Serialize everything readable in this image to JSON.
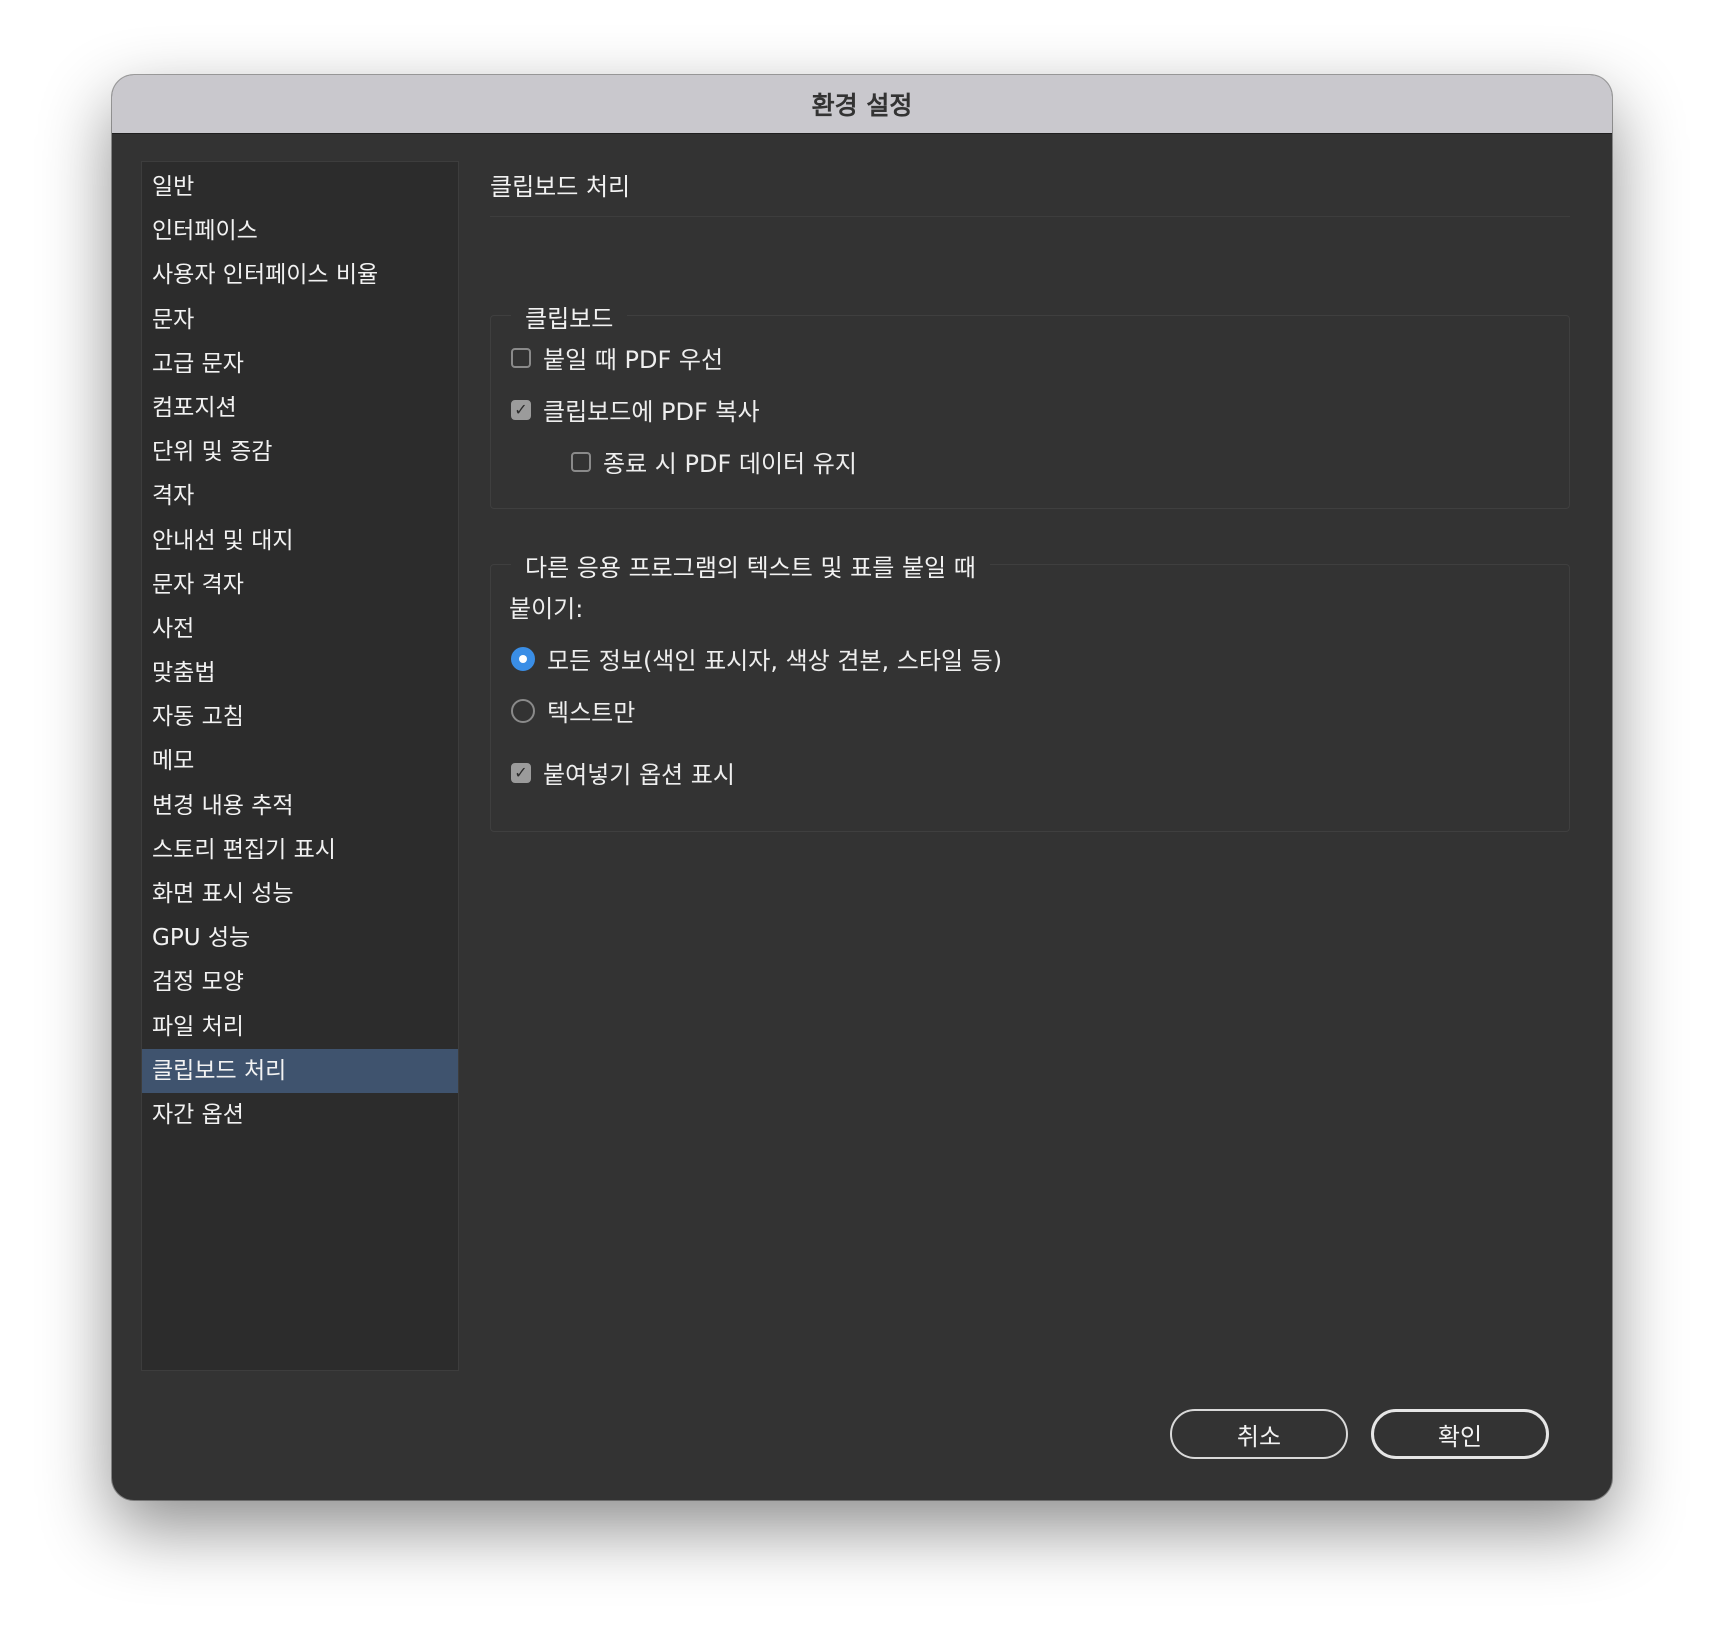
{
  "window": {
    "title": "환경 설정"
  },
  "sidebar": {
    "items": [
      {
        "label": "일반"
      },
      {
        "label": "인터페이스"
      },
      {
        "label": "사용자 인터페이스 비율"
      },
      {
        "label": "문자"
      },
      {
        "label": "고급 문자"
      },
      {
        "label": "컴포지션"
      },
      {
        "label": "단위 및 증감"
      },
      {
        "label": "격자"
      },
      {
        "label": "안내선 및 대지"
      },
      {
        "label": "문자 격자"
      },
      {
        "label": "사전"
      },
      {
        "label": "맞춤법"
      },
      {
        "label": "자동 고침"
      },
      {
        "label": "메모"
      },
      {
        "label": "변경 내용 추적"
      },
      {
        "label": "스토리 편집기 표시"
      },
      {
        "label": "화면 표시 성능"
      },
      {
        "label": "GPU 성능"
      },
      {
        "label": "검정 모양"
      },
      {
        "label": "파일 처리"
      },
      {
        "label": "클립보드 처리"
      },
      {
        "label": "자간 옵션"
      }
    ],
    "selected": "클립보드 처리"
  },
  "content": {
    "title": "클립보드 처리",
    "clipboard_group": {
      "legend": "클립보드",
      "prefer_pdf": {
        "label": "붙일 때 PDF 우선",
        "checked": false
      },
      "copy_pdf": {
        "label": "클립보드에 PDF 복사",
        "checked": true
      },
      "preserve_pdf": {
        "label": "종료 시 PDF 데이터 유지",
        "checked": false
      }
    },
    "paste_group": {
      "legend": "다른 응용 프로그램의 텍스트 및 표를 붙일 때",
      "paste_label": "붙이기:",
      "all_info": {
        "label": "모든 정보(색인 표시자, 색상 견본, 스타일 등)",
        "selected": true
      },
      "text_only": {
        "label": "텍스트만",
        "selected": false
      },
      "show_options": {
        "label": "붙여넣기 옵션 표시",
        "checked": true
      }
    }
  },
  "buttons": {
    "cancel": "취소",
    "ok": "확인"
  },
  "colors": {
    "accent": "#3a8ee6",
    "selection": "#3f536e",
    "background": "#333333"
  }
}
